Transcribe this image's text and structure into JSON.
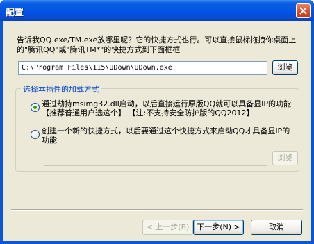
{
  "window": {
    "title": "配置"
  },
  "description": "告诉我QQ.exe/TM.exe放哪里呢？它的快捷方式也行。可以直接鼠标拖拽你桌面上的\"腾讯QQ\"或\"腾讯TM*\"的快捷方式到下面框框",
  "path": {
    "value": "C:\\Program Files\\115\\UDown\\UDown.exe",
    "browse_label": "浏览"
  },
  "group": {
    "title": "选择本插件的加载方式",
    "option1": {
      "label": "通过劫持msimg32.dll启动，以后直接运行原版QQ就可以具备显IP的功能 【推荐普通用户选这个】 【注:不支持安全防护版的QQ2012】",
      "selected": true
    },
    "option2": {
      "label": "创建一个新的快捷方式，以后要通过这个快捷方式来启动QQ才具备显IP的功能",
      "selected": false
    },
    "shortcut": {
      "value": "",
      "browse_label": "浏览"
    }
  },
  "buttons": {
    "prev": "< 上一步(B)",
    "next": "下一步(N) >",
    "cancel": "取消"
  },
  "colors": {
    "titlebar": "#0054e3",
    "face": "#ece9d8",
    "group_title": "#0046d5",
    "radio_dot": "#21a121",
    "close": "#d74a22"
  }
}
